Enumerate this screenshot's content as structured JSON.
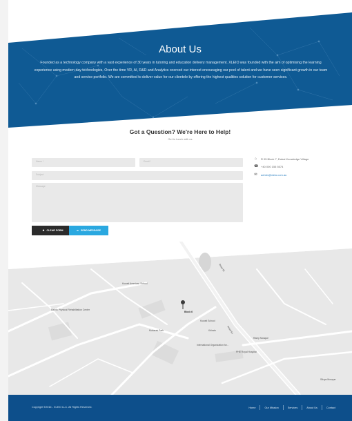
{
  "hero": {
    "title": "About Us",
    "text": "Founded as a technology company with a vast experience of 30 years in tutoring and education delivery management. XLEIO was founded with the aim of optimising the learning experience using modern day technologies. Over the time VR, AI, R&D and Analytics coerced our interest encouraging our pool of talent and we have seen significant growth in our team and service portfolio. We are committed to deliver value for our clientele by offering the highest qualities solution for customer services."
  },
  "contact": {
    "title": "Got a Question? We're Here to Help!",
    "subtitle": "Get in touch with us",
    "placeholders": {
      "name": "Name *",
      "email": "Email *",
      "subject": "Subject",
      "message": "Message"
    },
    "clear_label": "CLEAR FORM",
    "send_label": "SEND MESSAGE",
    "address": "R 05 Block 7, Dubai Knowledge Village",
    "phone": "+40 000 155 5074",
    "email": "admin@xleio.com.au"
  },
  "map": {
    "labels": {
      "school": "Kuwait American School",
      "block": "Block 6",
      "clinic": "Baddo Physical Rehabilitation Center",
      "museum": "Mubarak Park",
      "kuwait_school": "Kuwait School",
      "khiratn": "Khiratn",
      "intl_org": "International Organization for...",
      "ramp_mosque": "Ramp Mosque",
      "phe_hospital": "PHE Royal Hospital",
      "road_a": "Road 52",
      "road_b": "Road 54",
      "right_edge": "Sikrya Mosque"
    }
  },
  "footer": {
    "copyright": "Copyright ©2016 - XLEIO LLC. All Rights Reserved.",
    "links": [
      "Home",
      "Our Mission",
      "Services",
      "About Us",
      "Contact"
    ]
  }
}
